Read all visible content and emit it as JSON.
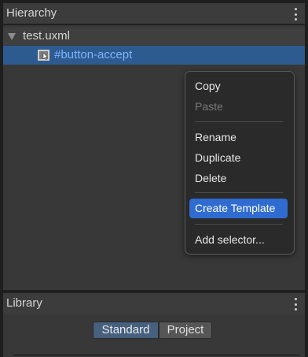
{
  "hierarchy": {
    "title": "Hierarchy",
    "root_label": "test.uxml",
    "child_label": "#button-accept"
  },
  "context_menu": {
    "items": [
      {
        "label": "Copy",
        "enabled": true
      },
      {
        "label": "Paste",
        "enabled": false
      },
      {
        "label": "Rename",
        "enabled": true
      },
      {
        "label": "Duplicate",
        "enabled": true
      },
      {
        "label": "Delete",
        "enabled": true
      },
      {
        "label": "Create Template",
        "enabled": true,
        "highlighted": true
      },
      {
        "label": "Add selector...",
        "enabled": true
      }
    ]
  },
  "library": {
    "title": "Library",
    "tabs": [
      "Standard",
      "Project"
    ],
    "selected_tab": "Standard"
  },
  "colors": {
    "selection": "#2d5b8f",
    "menu_highlight": "#2f6bd0",
    "link_text": "#7fb4ff"
  },
  "icons": {
    "panel_menu": "kebab-icon",
    "tree_toggle": "triangle-down-icon",
    "element": "visual-element-icon"
  }
}
